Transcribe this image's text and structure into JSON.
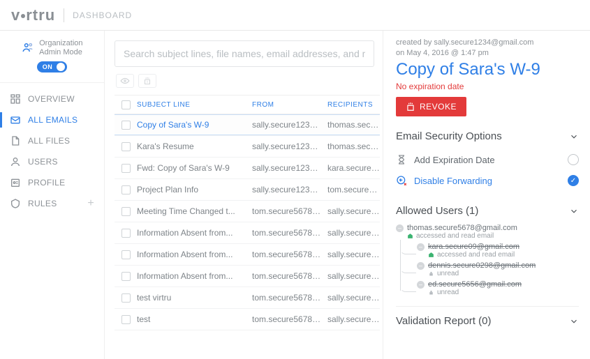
{
  "header": {
    "logo_text": "virtru",
    "section": "DASHBOARD"
  },
  "sidebar": {
    "org_label_line1": "Organization",
    "org_label_line2": "Admin Mode",
    "toggle_label": "ON",
    "items": [
      {
        "label": "OVERVIEW",
        "icon": "overview-icon"
      },
      {
        "label": "ALL EMAILS",
        "icon": "emails-icon"
      },
      {
        "label": "ALL FILES",
        "icon": "files-icon"
      },
      {
        "label": "USERS",
        "icon": "users-icon"
      },
      {
        "label": "PROFILE",
        "icon": "profile-icon"
      },
      {
        "label": "RULES",
        "icon": "rules-icon"
      }
    ],
    "active_index": 1
  },
  "search": {
    "placeholder": "Search subject lines, file names, email addresses, and more"
  },
  "columns": {
    "subject": "SUBJECT LINE",
    "from": "FROM",
    "recipients": "RECIPIENTS"
  },
  "emails": [
    {
      "subject": "Copy of Sara's W-9",
      "from": "sally.secure1234@g...",
      "recipients": "thomas.secu..."
    },
    {
      "subject": "Kara's Resume",
      "from": "sally.secure1234@g...",
      "recipients": "thomas.secu..."
    },
    {
      "subject": "Fwd: Copy of Sara's W-9",
      "from": "sally.secure1234@g...",
      "recipients": "kara.secure0..."
    },
    {
      "subject": "Project Plan Info",
      "from": "sally.secure1234@g...",
      "recipients": "tom.secure5..."
    },
    {
      "subject": "Meeting Time Changed t...",
      "from": "tom.secure5678@g...",
      "recipients": "sally.secure1..."
    },
    {
      "subject": "Information Absent from...",
      "from": "tom.secure5678@g...",
      "recipients": "sally.secure1..."
    },
    {
      "subject": "Information Absent from...",
      "from": "tom.secure5678@g...",
      "recipients": "sally.secure1..."
    },
    {
      "subject": "Information Absent from...",
      "from": "tom.secure5678@g...",
      "recipients": "sally.secure1..."
    },
    {
      "subject": "test virtru",
      "from": "tom.secure5678@g...",
      "recipients": "sally.secure1..."
    },
    {
      "subject": "test",
      "from": "tom.secure5678@g...",
      "recipients": "sally.secure1..."
    }
  ],
  "selected_index": 0,
  "detail": {
    "created_by_prefix": "created by ",
    "created_by": "sally.secure1234@gmail.com",
    "created_on_prefix": "on ",
    "created_on": "May 4, 2016 @ 1:47 pm",
    "title": "Copy of Sara's W-9",
    "expiration": "No expiration date",
    "revoke_label": "REVOKE",
    "security_header": "Email Security Options",
    "add_expiration": "Add Expiration Date",
    "disable_forwarding": "Disable Forwarding",
    "allowed_header": "Allowed Users (1)",
    "users": {
      "root": {
        "email": "thomas.secure5678@gmail.com",
        "status": "accessed and read email",
        "status_icon": "open"
      },
      "children": [
        {
          "email": "kara.secure09@gmail.com",
          "status": "accessed and read email",
          "status_icon": "open",
          "struck": true
        },
        {
          "email": "dennis.secure0298@gmail.com",
          "status": "unread",
          "status_icon": "lock",
          "struck": true
        },
        {
          "email": "ed.secure5656@gmail.com",
          "status": "unread",
          "status_icon": "lock",
          "struck": true
        }
      ]
    },
    "validation_header": "Validation Report (0)"
  }
}
